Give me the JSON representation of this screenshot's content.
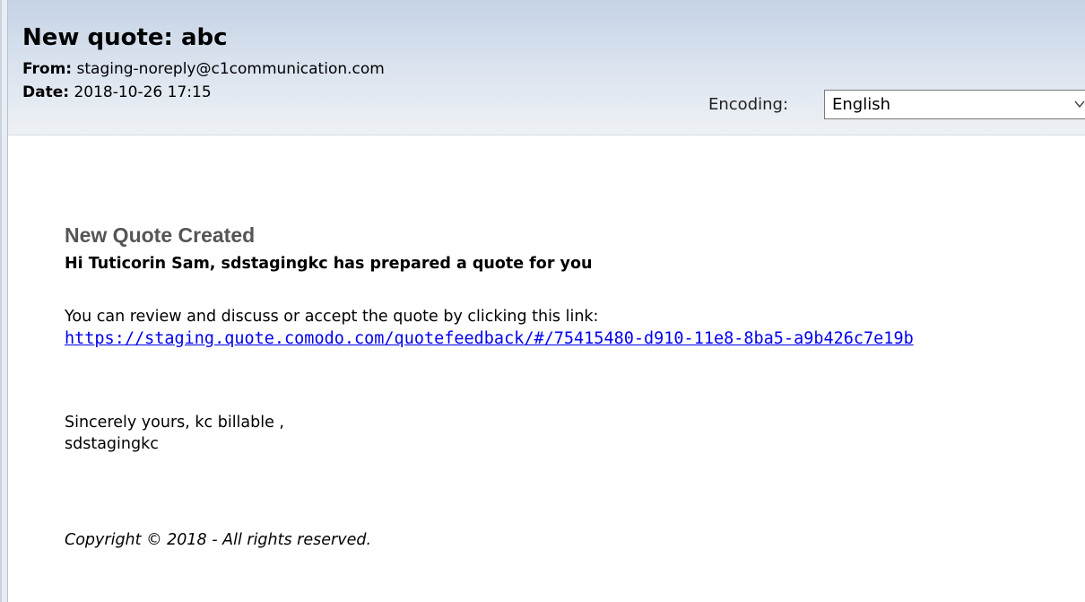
{
  "email": {
    "subject": "New quote: abc",
    "from_label": "From:",
    "from_value": " staging-noreply@c1communication.com",
    "date_label": "Date:",
    "date_value": " 2018-10-26 17:15"
  },
  "encoding": {
    "label": "Encoding:",
    "selected": "English"
  },
  "message": {
    "title": "New Quote Created",
    "greeting": "Hi Tuticorin Sam, sdstagingkc has prepared a quote for you",
    "review_text": "You can review and discuss or accept the quote by clicking this link:",
    "link": "https://staging.quote.comodo.com/quotefeedback/#/75415480-d910-11e8-8ba5-a9b426c7e19b",
    "signoff": "Sincerely yours, kc billable ,",
    "signer": "sdstagingkc",
    "copyright": "Copyright © 2018 - All rights reserved."
  },
  "colors": {
    "link": "#0000ee",
    "title": "#555555",
    "header_top": "#c5d3e6",
    "header_bottom": "#eef1f5"
  },
  "icons": {
    "encoding_dropdown": "chevron-down-icon"
  }
}
